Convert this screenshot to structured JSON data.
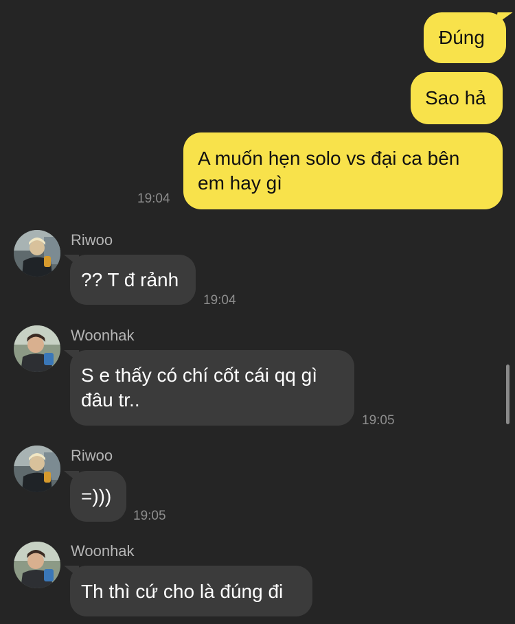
{
  "messages": [
    {
      "text": "Đúng"
    },
    {
      "text": "Sao hả"
    },
    {
      "text": "A muốn hẹn solo vs đại ca bên em hay gì",
      "time": "19:04"
    },
    {
      "sender": "Riwoo",
      "text": "?? T đ rảnh",
      "time": "19:04"
    },
    {
      "sender": "Woonhak",
      "text": "S e thấy có chí cốt cái qq gì đâu tr..",
      "time": "19:05"
    },
    {
      "sender": "Riwoo",
      "text": "=)))",
      "time": "19:05"
    },
    {
      "sender": "Woonhak",
      "text": "Th thì cứ cho là đúng đi"
    }
  ],
  "colors": {
    "background": "#252525",
    "outgoing_bubble": "#f8e24b",
    "incoming_bubble": "#3b3b3b",
    "timestamp": "#8d8d8d",
    "sender_name": "#b5b5b5"
  },
  "icons": [
    "riwoo-avatar",
    "woonhak-avatar"
  ]
}
